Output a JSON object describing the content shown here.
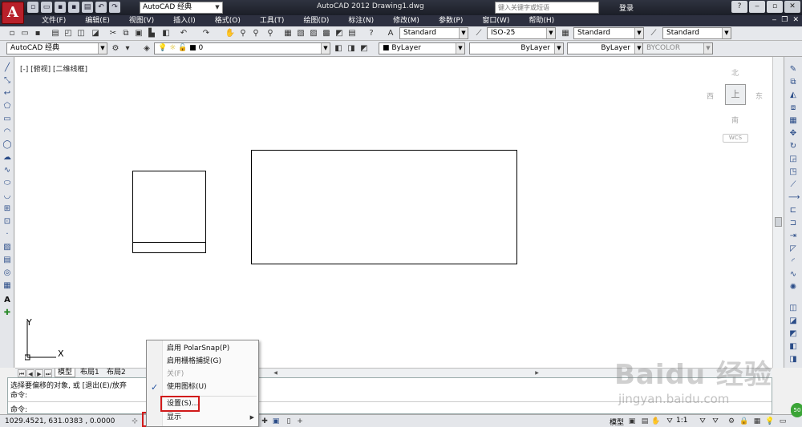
{
  "titlebar": {
    "logo_letter": "A",
    "workspace": "AutoCAD 经典",
    "title": "AutoCAD 2012    Drawing1.dwg",
    "search_placeholder": "键入关键字或短语",
    "login": "登录",
    "help_icon": "?"
  },
  "menu": {
    "items": [
      "文件(F)",
      "编辑(E)",
      "视图(V)",
      "插入(I)",
      "格式(O)",
      "工具(T)",
      "绘图(D)",
      "标注(N)",
      "修改(M)",
      "参数(P)",
      "窗口(W)",
      "帮助(H)"
    ]
  },
  "toolbar1": {
    "text_style": "Standard",
    "dim_style": "ISO-25",
    "table_style": "Standard",
    "mleader_style": "Standard"
  },
  "toolbar2": {
    "workspace": "AutoCAD 经典",
    "layer": "0",
    "color": "ByLayer",
    "linetype": "ByLayer",
    "lineweight": "ByLayer",
    "plotstyle": "BYCOLOR"
  },
  "viewport": {
    "label": "[-] [俯视] [二维线框]"
  },
  "viewcube": {
    "north": "北",
    "south": "南",
    "east": "东",
    "west": "西",
    "face": "上",
    "wcs": "WCS"
  },
  "ucs": {
    "x_label": "X",
    "y_label": "Y"
  },
  "tabs": {
    "items": [
      "模型",
      "布局1",
      "布局2"
    ],
    "active": "模型"
  },
  "command": {
    "line1": "选择要偏移的对象, 或 [退出(E)/放弃",
    "line2": "命令:",
    "prompt": "命令:"
  },
  "status": {
    "coords": "1029.4521, 631.0383 , 0.0000",
    "model": "模型",
    "scale": "1:1"
  },
  "context_menu": {
    "items": [
      {
        "label": "启用 PolarSnap(P)",
        "checked": false,
        "disabled": false
      },
      {
        "label": "启用栅格捕捉(G)",
        "checked": false,
        "disabled": false
      },
      {
        "label": "关(F)",
        "checked": false,
        "disabled": true
      },
      {
        "label": "使用图标(U)",
        "checked": true,
        "disabled": false
      },
      {
        "label": "设置(S)...",
        "checked": false,
        "disabled": false
      },
      {
        "label": "显示",
        "checked": false,
        "disabled": false,
        "submenu": true
      }
    ]
  },
  "watermark": {
    "brand": "Baidu 经验",
    "url": "jingyan.baidu.com"
  },
  "badge": "50"
}
